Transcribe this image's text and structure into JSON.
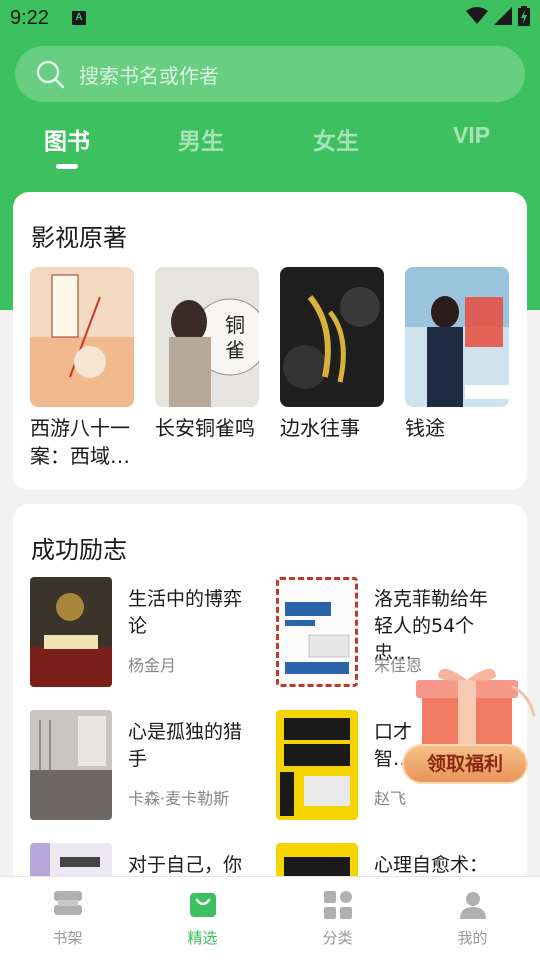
{
  "status_bar": {
    "time": "9:22",
    "notification_badge": "A"
  },
  "search": {
    "placeholder": "搜索书名或作者"
  },
  "tabs": [
    {
      "label": "图书",
      "active": true
    },
    {
      "label": "男生",
      "active": false
    },
    {
      "label": "女生",
      "active": false
    },
    {
      "label": "VIP",
      "active": false
    }
  ],
  "section_adaptations": {
    "title": "影视原著",
    "books": [
      {
        "title": "西游八十一案：西域…"
      },
      {
        "title": "长安铜雀鸣"
      },
      {
        "title": "边水往事"
      },
      {
        "title": "钱途"
      }
    ]
  },
  "section_inspiration": {
    "title": "成功励志",
    "books": [
      {
        "title": "生活中的博弈论",
        "author": "杨金月"
      },
      {
        "title": "洛克菲勒给年轻人的54个忠…",
        "author": "宋佳恩"
      },
      {
        "title": "心是孤独的猎手",
        "author": "卡森·麦卡勒斯"
      },
      {
        "title": "口才智…",
        "author": "赵飞"
      },
      {
        "title": "对于自己，你",
        "author": ""
      },
      {
        "title": "心理自愈术：",
        "author": ""
      }
    ]
  },
  "promo": {
    "label": "领取福利"
  },
  "bottom_nav": [
    {
      "label": "书架",
      "active": false
    },
    {
      "label": "精选",
      "active": true
    },
    {
      "label": "分类",
      "active": false
    },
    {
      "label": "我的",
      "active": false
    }
  ],
  "colors": {
    "brand_green": "#3dc05f",
    "promo_orange": "#e8935a"
  }
}
